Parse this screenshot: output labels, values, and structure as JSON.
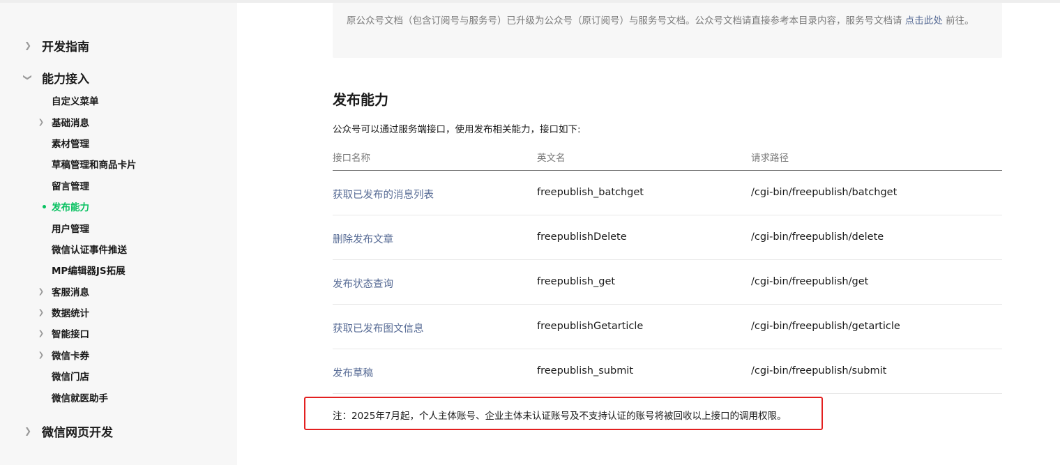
{
  "sidebar": {
    "top_items": [
      {
        "label": "开发指南",
        "expanded": false
      },
      {
        "label": "能力接入",
        "expanded": true
      },
      {
        "label": "微信网页开发",
        "expanded": false
      }
    ],
    "sub_items": [
      {
        "label": "自定义菜单",
        "has_children": false
      },
      {
        "label": "基础消息",
        "has_children": true
      },
      {
        "label": "素材管理",
        "has_children": false
      },
      {
        "label": "草稿管理和商品卡片",
        "has_children": false
      },
      {
        "label": "留言管理",
        "has_children": false
      },
      {
        "label": "发布能力",
        "has_children": false,
        "active": true
      },
      {
        "label": "用户管理",
        "has_children": false
      },
      {
        "label": "微信认证事件推送",
        "has_children": false
      },
      {
        "label": "MP编辑器JS拓展",
        "has_children": false
      },
      {
        "label": "客服消息",
        "has_children": true
      },
      {
        "label": "数据统计",
        "has_children": true
      },
      {
        "label": "智能接口",
        "has_children": true
      },
      {
        "label": "微信卡券",
        "has_children": true
      },
      {
        "label": "微信门店",
        "has_children": false
      },
      {
        "label": "微信就医助手",
        "has_children": false
      }
    ],
    "active_color": "#07c160"
  },
  "notice": {
    "text_before": "原公众号文档（包含订阅号与服务号）已升级为公众号（原订阅号）与服务号文档。公众号文档请直接参考本目录内容，服务号文档请",
    "link_text": "点击此处",
    "text_after": "前往。"
  },
  "section": {
    "title": "发布能力",
    "description": "公众号可以通过服务端接口，使用发布相关能力，接口如下:"
  },
  "table": {
    "headers": [
      "接口名称",
      "英文名",
      "请求路径"
    ],
    "rows": [
      {
        "name": "获取已发布的消息列表",
        "en": "freepublish_batchget",
        "path": "/cgi-bin/freepublish/batchget"
      },
      {
        "name": "删除发布文章",
        "en": "freepublishDelete",
        "path": "/cgi-bin/freepublish/delete"
      },
      {
        "name": "发布状态查询",
        "en": "freepublish_get",
        "path": "/cgi-bin/freepublish/get"
      },
      {
        "name": "获取已发布图文信息",
        "en": "freepublishGetarticle",
        "path": "/cgi-bin/freepublish/getarticle"
      },
      {
        "name": "发布草稿",
        "en": "freepublish_submit",
        "path": "/cgi-bin/freepublish/submit"
      }
    ]
  },
  "note": {
    "text": "注：2025年7月起，个人主体账号、企业主体未认证账号及不支持认证的账号将被回收以上接口的调用权限。",
    "highlight_color": "#e32020"
  },
  "colors": {
    "link": "#576b95",
    "muted": "#7a7a7a"
  }
}
